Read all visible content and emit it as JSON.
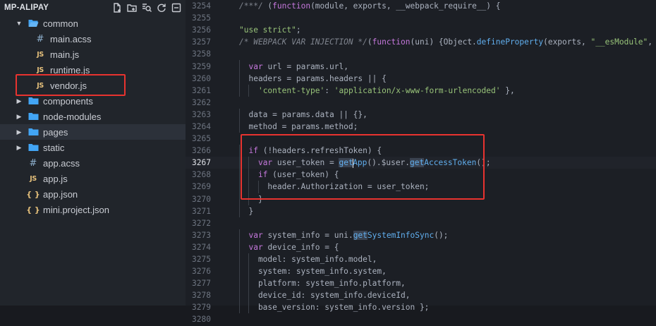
{
  "explorer": {
    "title": "MP-ALIPAY",
    "tool_icons": [
      "new-file-icon",
      "new-folder-icon",
      "search-icon",
      "refresh-icon",
      "collapse-all-icon"
    ],
    "items": [
      {
        "label": "common",
        "type": "folder-open",
        "expanded": true
      },
      {
        "label": "main.acss",
        "type": "acss"
      },
      {
        "label": "main.js",
        "type": "js"
      },
      {
        "label": "runtime.js",
        "type": "js"
      },
      {
        "label": "vendor.js",
        "type": "js"
      },
      {
        "label": "components",
        "type": "folder",
        "expanded": false
      },
      {
        "label": "node-modules",
        "type": "folder",
        "expanded": false
      },
      {
        "label": "pages",
        "type": "folder",
        "expanded": false
      },
      {
        "label": "static",
        "type": "folder",
        "expanded": false
      },
      {
        "label": "app.acss",
        "type": "acss"
      },
      {
        "label": "app.js",
        "type": "js"
      },
      {
        "label": "app.json",
        "type": "json"
      },
      {
        "label": "mini.project.json",
        "type": "json"
      }
    ],
    "icon_glyphs": {
      "js": "JS",
      "acss": "#",
      "json": "{ }"
    }
  },
  "editor": {
    "current_line": "3267",
    "lines": [
      {
        "n": "3254",
        "t": "/***/ (function(module, exports, __webpack_require__) {"
      },
      {
        "n": "3255",
        "t": ""
      },
      {
        "n": "3256",
        "t": "\"use strict\";"
      },
      {
        "n": "3257",
        "t": "/* WEBPACK VAR INJECTION */(function(uni) {Object.defineProperty(exports, \"__esModule\", {"
      },
      {
        "n": "3258",
        "t": ""
      },
      {
        "n": "3259",
        "t": "  var url = params.url,"
      },
      {
        "n": "3260",
        "t": "  headers = params.headers || {"
      },
      {
        "n": "3261",
        "t": "    'content-type': 'application/x-www-form-urlencoded' },"
      },
      {
        "n": "3262",
        "t": ""
      },
      {
        "n": "3263",
        "t": "  data = params.data || {},"
      },
      {
        "n": "3264",
        "t": "  method = params.method;"
      },
      {
        "n": "3265",
        "t": ""
      },
      {
        "n": "3266",
        "t": "  if (!headers.refreshToken) {"
      },
      {
        "n": "3267",
        "t": "    var user_token = getApp().$user.getAccessToken();"
      },
      {
        "n": "3268",
        "t": "    if (user_token) {"
      },
      {
        "n": "3269",
        "t": "      header.Authorization = user_token;"
      },
      {
        "n": "3270",
        "t": "    }"
      },
      {
        "n": "3271",
        "t": "  }"
      },
      {
        "n": "3272",
        "t": ""
      },
      {
        "n": "3273",
        "t": "  var system_info = uni.getSystemInfoSync();"
      },
      {
        "n": "3274",
        "t": "  var device_info = {"
      },
      {
        "n": "3275",
        "t": "    model: system_info.model,"
      },
      {
        "n": "3276",
        "t": "    system: system_info.system,"
      },
      {
        "n": "3277",
        "t": "    platform: system_info.platform,"
      },
      {
        "n": "3278",
        "t": "    device_id: system_info.deviceId,"
      },
      {
        "n": "3279",
        "t": "    base_version: system_info.version };"
      },
      {
        "n": "3280",
        "t": ""
      }
    ]
  },
  "colors": {
    "highlight_box": "#e8332f",
    "folder": "#42a5f5",
    "js_icon": "#e5c07b",
    "keyword": "#c678dd",
    "string": "#98c379",
    "function": "#61afef",
    "comment": "#7f848e"
  }
}
